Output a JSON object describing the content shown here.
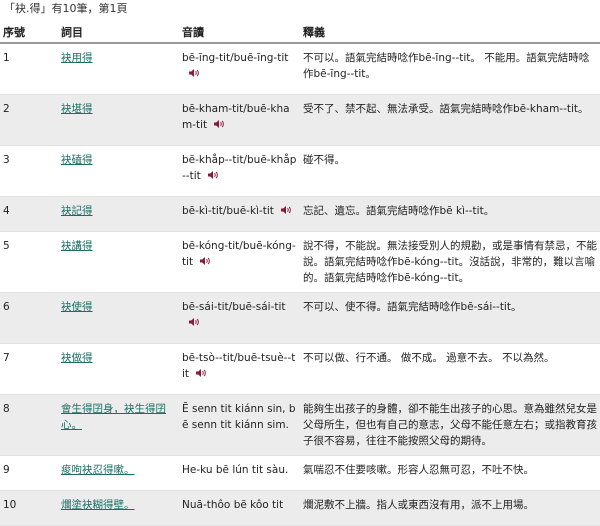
{
  "summary": "「袂.得」有10筆，第1頁",
  "headers": {
    "num": "序號",
    "word": "詞目",
    "pron": "音讀",
    "def": "釋義"
  },
  "rows": [
    {
      "num": "1",
      "word": "袂用得",
      "pron": "bē-īng-tit/buē-īng-tit",
      "def": "不可以。語氣完結時唸作bē-īng--tit。 不能用。語氣完結時唸作bē-īng--tit。"
    },
    {
      "num": "2",
      "word": "袂堪得",
      "pron": "bē-kham-tit/buē-kham-tit",
      "def": "受不了、禁不起、無法承受。語氣完結時唸作bē-kham--tit。"
    },
    {
      "num": "3",
      "word": "袂磕得",
      "pron": "bē-khåp--tit/buē-khåp--tit",
      "def": "碰不得。"
    },
    {
      "num": "4",
      "word": "袂記得",
      "pron": "bē-kì-tit/buē-kì-tit",
      "def": "忘記、遺忘。語氣完結時唸作bē kì--tit。"
    },
    {
      "num": "5",
      "word": "袂講得",
      "pron": "bē-kóng-tit/buē-kóng-tit",
      "def": "說不得，不能說。無法接受別人的規勸，或是事情有禁忌，不能說。語氣完結時唸作bē-kóng--tit。沒話說，非常的，難以言喻的。語氣完結時唸作bē-kóng--tit。"
    },
    {
      "num": "6",
      "word": "袂使得",
      "pron": "bē-sái-tit/buē-sái-tit",
      "def": "不可以、使不得。語氣完結時唸作bē-sái--tit。"
    },
    {
      "num": "7",
      "word": "袂做得",
      "pron": "bē-tsò--tit/buē-tsuè--tit",
      "def": "不可以做、行不通。 做不成。 過意不去。 不以為然。"
    },
    {
      "num": "8",
      "word": "會生得囝身，袂生得囝心。",
      "pron": "Ē senn tit kiánn sin, bē senn tit kiánn sim.",
      "def": "能夠生出孩子的身體，卻不能生出孩子的心思。意為雖然兒女是父母所生，但也有自己的意志，父母不能任意左右；或指教育孩子很不容易，往往不能按照父母的期待。"
    },
    {
      "num": "9",
      "word": "痠呴袂忍得嗽。",
      "pron": "He-ku bē lún tit sàu.",
      "def": "氣喘忍不住要咳嗽。形容人忍無可忍，不吐不快。"
    },
    {
      "num": "10",
      "word": "爛塗袂糊得壁。",
      "pron": "Nuā-thôo bē kôo tit",
      "def": "爛泥敷不上牆。指人或東西沒有用，派不上用場。"
    }
  ],
  "colors": {
    "link": "#1a6f64",
    "speaker": "#8b1a3a",
    "alt_row": "#ececec"
  },
  "icons": {
    "speaker": "speaker-icon"
  }
}
